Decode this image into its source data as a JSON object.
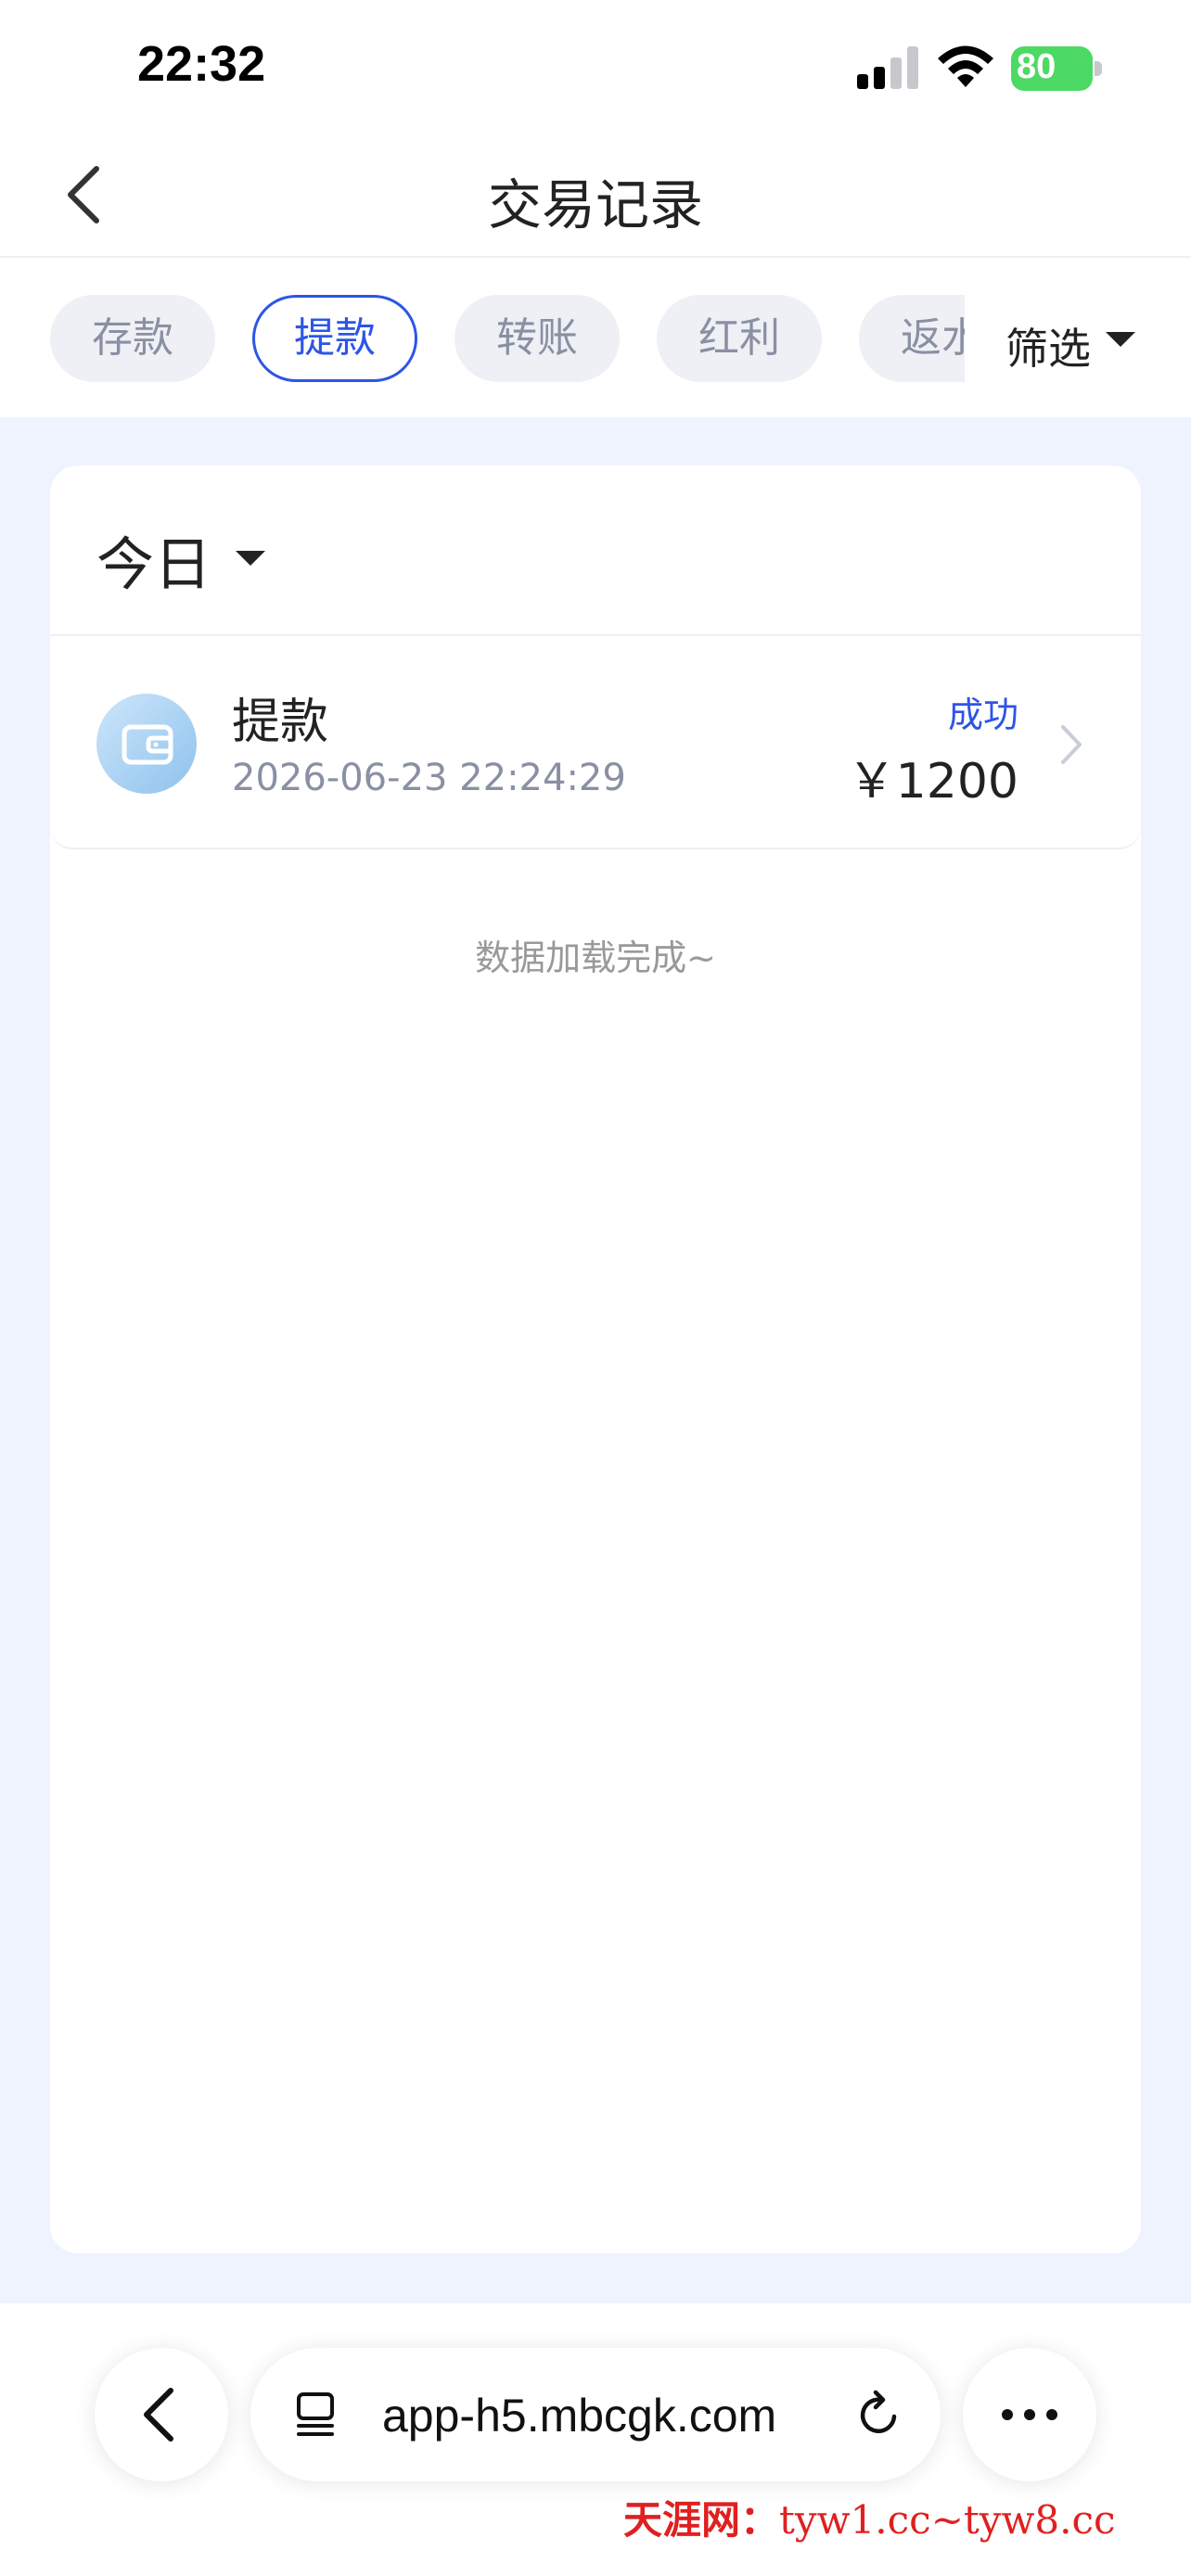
{
  "status_bar": {
    "time": "22:32",
    "battery": "80"
  },
  "header": {
    "title": "交易记录"
  },
  "tabs": [
    {
      "label": "存款",
      "active": false
    },
    {
      "label": "提款",
      "active": true
    },
    {
      "label": "转账",
      "active": false
    },
    {
      "label": "红利",
      "active": false
    },
    {
      "label": "返水",
      "active": false
    }
  ],
  "filter": {
    "label": "筛选"
  },
  "date_filter": {
    "label": "今日"
  },
  "records": [
    {
      "title": "提款",
      "time": "2026-06-23 22:24:29",
      "status": "成功",
      "amount": "￥1200"
    }
  ],
  "load_status": "数据加载完成~",
  "browser": {
    "url": "app-h5.mbcgk.com"
  },
  "watermark": {
    "brand": "天涯网：",
    "text": "tyw1.cc~tyw8.cc"
  },
  "colors": {
    "accent": "#2d55e6",
    "content_bg": "#eef3fd",
    "battery": "#4cd964"
  }
}
